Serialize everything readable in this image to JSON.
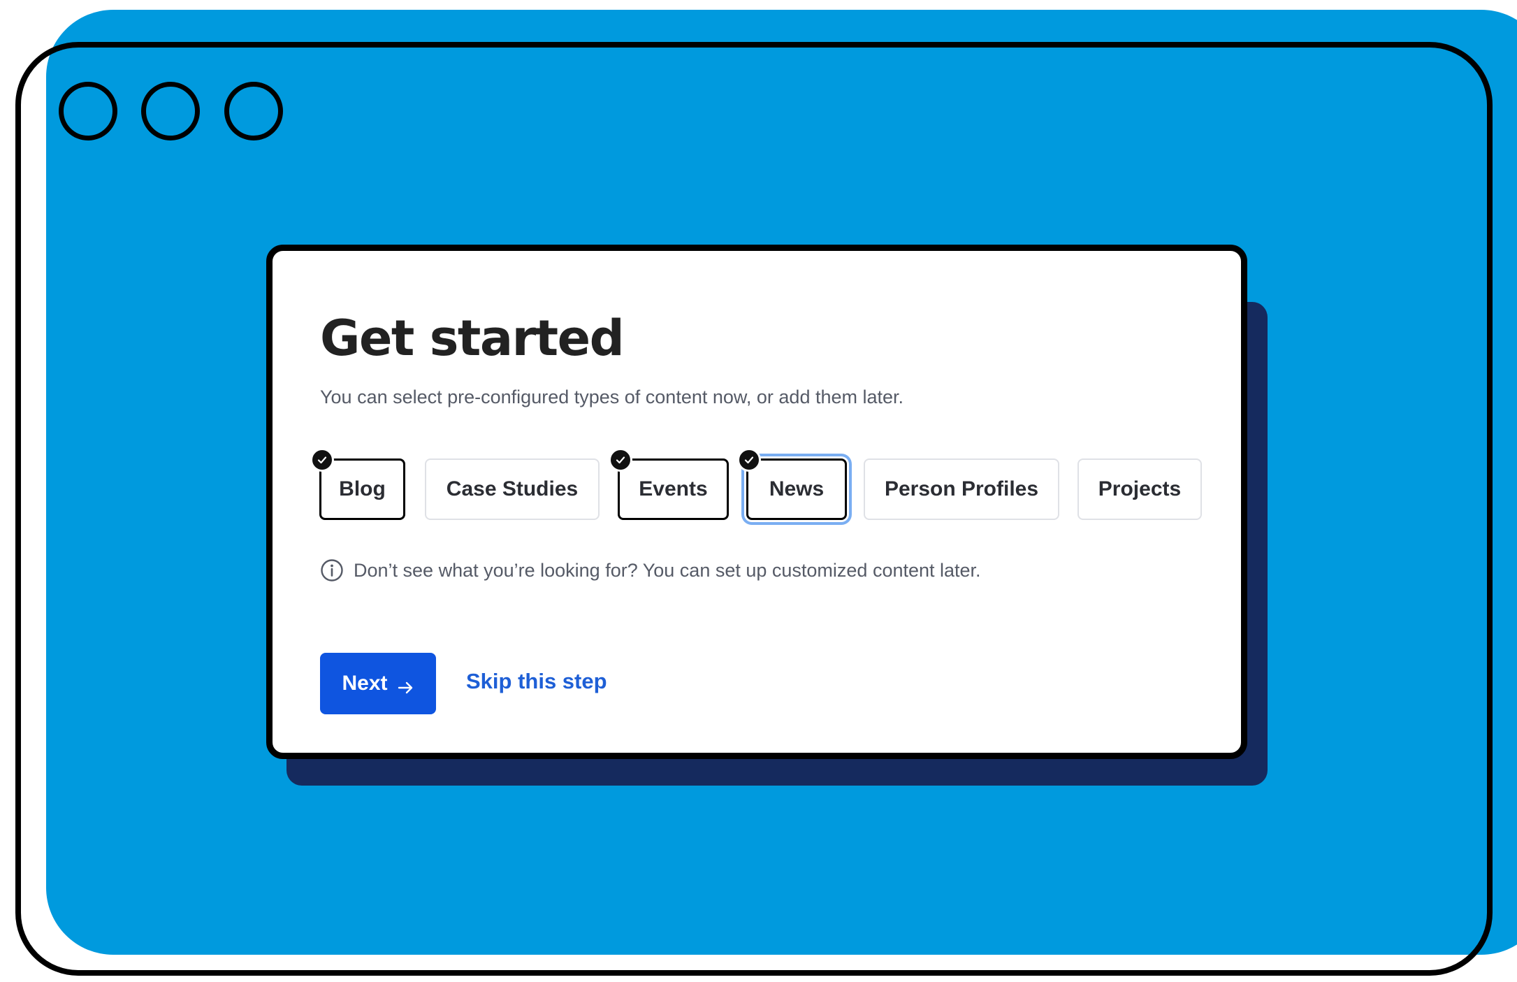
{
  "dialog": {
    "title": "Get started",
    "subtitle": "You can select pre-configured types of content now, or add them later.",
    "content_types": [
      {
        "label": "Blog",
        "selected": true
      },
      {
        "label": "Case Studies",
        "selected": false
      },
      {
        "label": "Events",
        "selected": true
      },
      {
        "label": "News",
        "selected": true,
        "focused": true
      },
      {
        "label": "Person Profiles",
        "selected": false
      },
      {
        "label": "Projects",
        "selected": false
      }
    ],
    "hint": "Don’t see what you’re looking for? You can set up customized content later.",
    "next_label": "Next",
    "skip_label": "Skip this step"
  },
  "icons": {
    "check": "check-icon",
    "info": "info-icon",
    "next_arrow": "arrow-right-icon"
  },
  "colors": {
    "background": "#009ADE",
    "card_shadow": "#152A5E",
    "primary": "#0F55E0",
    "link": "#1E5FD6",
    "focus_ring": "#7AAEF2"
  }
}
